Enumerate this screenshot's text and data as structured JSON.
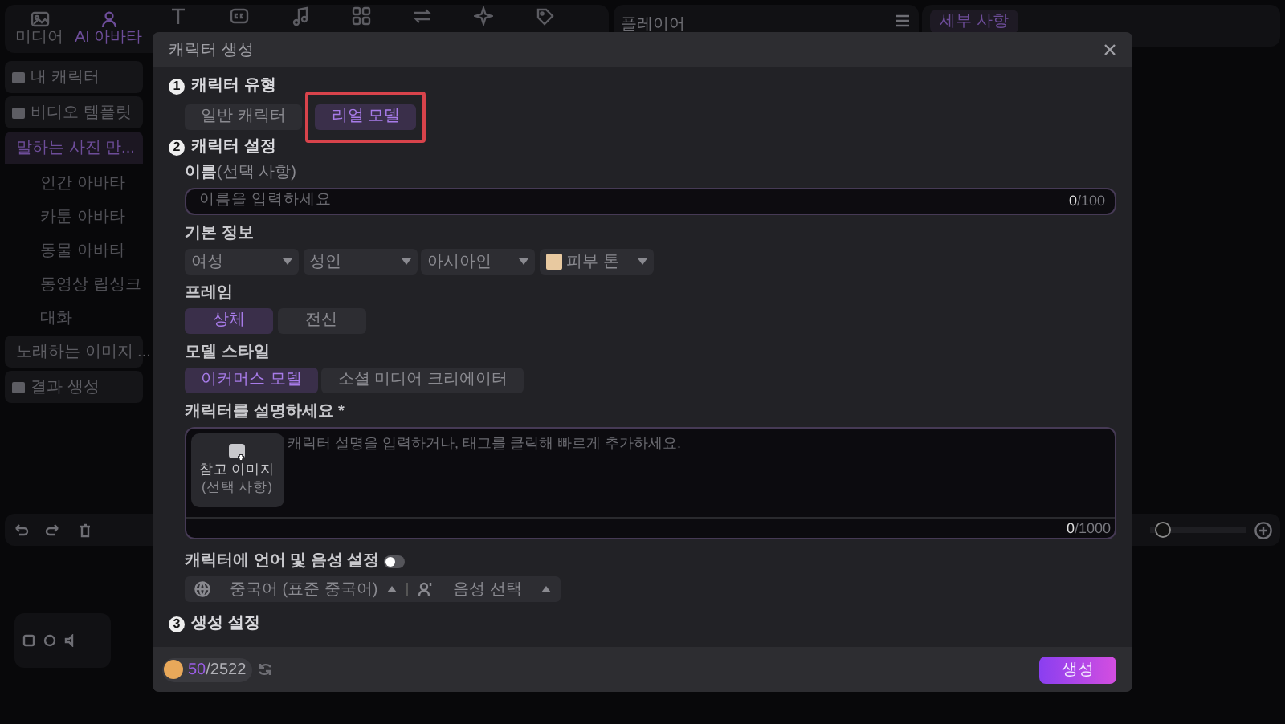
{
  "toolbar": {
    "tabs": [
      {
        "label": "미디어",
        "selected": false
      },
      {
        "label": "AI 아바타",
        "selected": true
      }
    ]
  },
  "player": {
    "title": "플레이어"
  },
  "details": {
    "tab": {
      "label": "세부 사항",
      "selected": true
    }
  },
  "sidebar": {
    "items": [
      {
        "label": "내 캐릭터",
        "selected": false
      },
      {
        "label": "비디오 템플릿",
        "selected": false
      },
      {
        "label": "말하는 사진 만...",
        "selected": true,
        "expanded": true,
        "children": [
          {
            "label": "인간 아바타",
            "selected": false
          },
          {
            "label": "카툰 아바타",
            "selected": false
          },
          {
            "label": "동물 아바타",
            "selected": false
          },
          {
            "label": "동영상 립싱크",
            "selected": false
          },
          {
            "label": "대화",
            "selected": false
          }
        ]
      },
      {
        "label": "노래하는 이미지 ...",
        "selected": false
      },
      {
        "label": "결과 생성",
        "selected": false
      }
    ]
  },
  "timeline": {
    "zoom_slider": {
      "level": 0.05
    }
  },
  "dialog": {
    "title": "캐릭터 생성",
    "sections": [
      {
        "number": "1",
        "title": "캐릭터 유형"
      },
      {
        "number": "2",
        "title": "캐릭터 설정"
      },
      {
        "number": "3",
        "title": "생성 설정"
      }
    ],
    "character_types": [
      {
        "label": "일반 캐릭터",
        "selected": false,
        "highlighted": false
      },
      {
        "label": "리얼 모델",
        "selected": true,
        "highlighted": true
      }
    ],
    "name": {
      "label": "**이름**(선택 사항)",
      "placeholder": "이름을 입력하세요",
      "counter": "**0**/100"
    },
    "basic_info": {
      "label": "기본 정보",
      "dropdowns": [
        {
          "kind": "plain",
          "value": "여성"
        },
        {
          "kind": "plain",
          "value": "성인"
        },
        {
          "kind": "plain",
          "value": "아시아인"
        },
        {
          "kind": "skin-tone",
          "value": "피부 톤"
        }
      ]
    },
    "frame": {
      "label": "프레임",
      "options": [
        {
          "label": "상체",
          "selected": true
        },
        {
          "label": "전신",
          "selected": false
        }
      ]
    },
    "model_style": {
      "label": "모델 스타일",
      "options": [
        {
          "label": "이커머스 모델",
          "selected": true
        },
        {
          "label": "소셜 미디어 크리에이터",
          "selected": false
        }
      ]
    },
    "description": {
      "label": "캐릭터를 설명하세요 *",
      "placeholder": "캐릭터 설명을 입력하거나, 태그를 클릭해 빠르게 추가하세요.",
      "reference_image": {
        "label": "참고 이미지",
        "hint": "(선택 사항)"
      },
      "counter": "**0**/1000"
    },
    "voice": {
      "label": "캐릭터에 언어 및 음성 설정",
      "on": false,
      "language": "중국어 (표준 중국어)",
      "voice": "음성 선택"
    },
    "credits": "**50**/2522",
    "generate_button": "생성"
  }
}
